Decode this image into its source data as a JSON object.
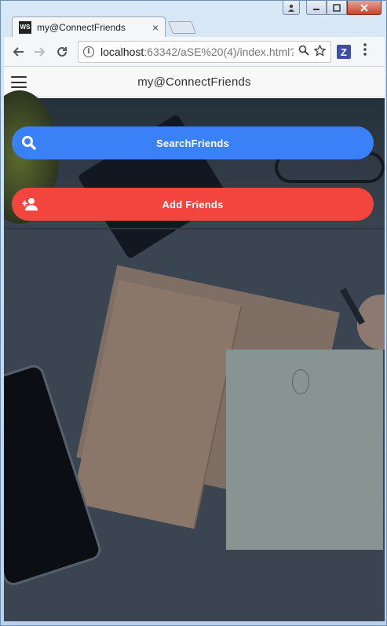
{
  "browser": {
    "tab_title": "my@ConnectFriends",
    "tab_favicon": "WS",
    "tab_close": "×",
    "url_host": "localhost",
    "url_rest": ":63342/aSE%20(4)/index.html?",
    "extension_letter": "Z"
  },
  "app": {
    "title": "my@ConnectFriends",
    "buttons": [
      {
        "label": "SearchFriends",
        "icon": "search-icon",
        "color": "#3a80f6"
      },
      {
        "label": "Add Friends",
        "icon": "add-person-icon",
        "color": "#f1453d"
      }
    ]
  }
}
